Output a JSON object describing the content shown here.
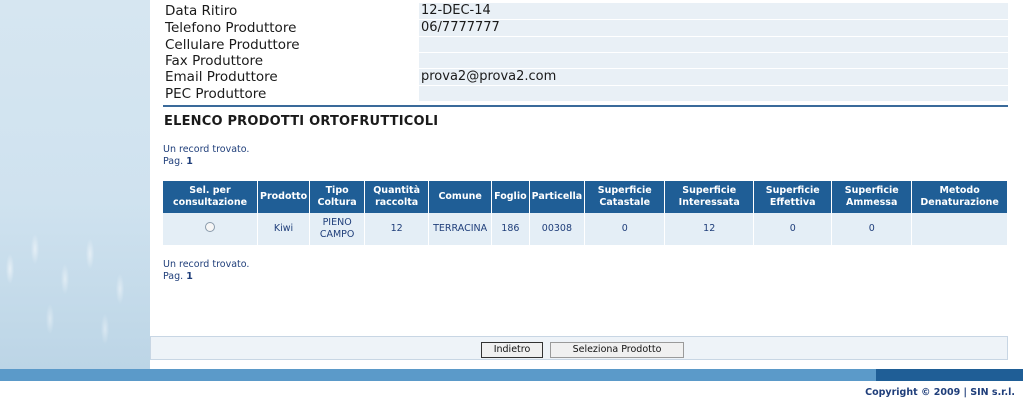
{
  "producer_info": [
    {
      "label": "Data Ritiro",
      "value": "12-DEC-14"
    },
    {
      "label": "Telefono Produttore",
      "value": "06/7777777"
    },
    {
      "label": "Cellulare Produttore",
      "value": ""
    },
    {
      "label": "Fax Produttore",
      "value": ""
    },
    {
      "label": "Email Produttore",
      "value": "prova2@prova2.com"
    },
    {
      "label": "PEC Produttore",
      "value": ""
    }
  ],
  "section_title": "ELENCO PRODOTTI ORTOFRUTTICOLI",
  "pager": {
    "records_text": "Un record trovato.",
    "page_label": "Pag.",
    "page_number": "1"
  },
  "table": {
    "headers": [
      "Sel. per consultazione",
      "Prodotto",
      "Tipo Coltura",
      "Quantità raccolta",
      "Comune",
      "Foglio",
      "Particella",
      "Superficie Catastale",
      "Superficie Interessata",
      "Superficie Effettiva",
      "Superficie Ammessa",
      "Metodo Denaturazione"
    ],
    "rows": [
      {
        "prodotto": "Kiwi",
        "tipo_coltura": "PIENO CAMPO",
        "quantita": "12",
        "comune": "TERRACINA",
        "foglio": "186",
        "particella": "00308",
        "sup_catastale": "0",
        "sup_interessata": "12",
        "sup_effettiva": "0",
        "sup_ammessa": "0",
        "metodo": ""
      }
    ]
  },
  "buttons": {
    "back": "Indietro",
    "select": "Seleziona Prodotto"
  },
  "footer": {
    "copyright": "Copyright © 2009 | SIN s.r.l."
  },
  "colors": {
    "header_blue": "#1f5e96",
    "bar_light_blue": "#5b9ac9",
    "row_bg": "#e4eef6"
  }
}
